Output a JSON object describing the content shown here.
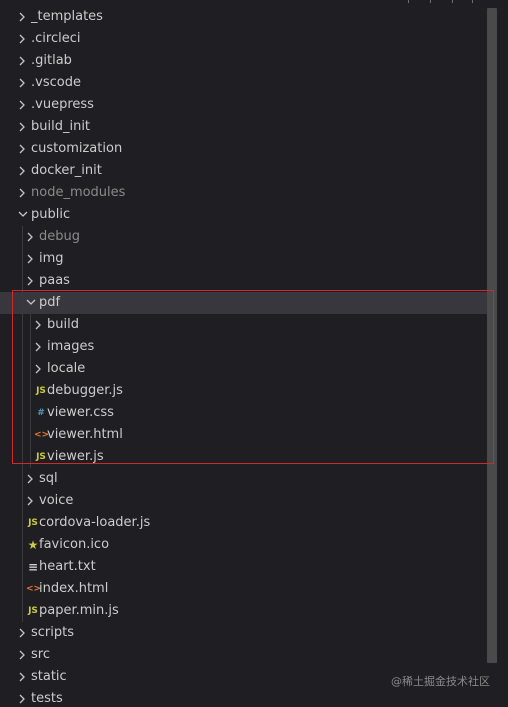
{
  "explorer": {
    "rows": [
      {
        "label": "_templates",
        "kind": "folder",
        "depth": 0,
        "open": false
      },
      {
        "label": ".circleci",
        "kind": "folder",
        "depth": 0,
        "open": false
      },
      {
        "label": ".gitlab",
        "kind": "folder",
        "depth": 0,
        "open": false
      },
      {
        "label": ".vscode",
        "kind": "folder",
        "depth": 0,
        "open": false
      },
      {
        "label": ".vuepress",
        "kind": "folder",
        "depth": 0,
        "open": false
      },
      {
        "label": "build_init",
        "kind": "folder",
        "depth": 0,
        "open": false
      },
      {
        "label": "customization",
        "kind": "folder",
        "depth": 0,
        "open": false
      },
      {
        "label": "docker_init",
        "kind": "folder",
        "depth": 0,
        "open": false
      },
      {
        "label": "node_modules",
        "kind": "folder",
        "depth": 0,
        "open": false,
        "muted": true
      },
      {
        "label": "public",
        "kind": "folder",
        "depth": 0,
        "open": true
      },
      {
        "label": "debug",
        "kind": "folder",
        "depth": 1,
        "open": false,
        "muted": true
      },
      {
        "label": "img",
        "kind": "folder",
        "depth": 1,
        "open": false
      },
      {
        "label": "paas",
        "kind": "folder",
        "depth": 1,
        "open": false
      },
      {
        "label": "pdf",
        "kind": "folder",
        "depth": 1,
        "open": true,
        "selected": true
      },
      {
        "label": "build",
        "kind": "folder",
        "depth": 2,
        "open": false
      },
      {
        "label": "images",
        "kind": "folder",
        "depth": 2,
        "open": false
      },
      {
        "label": "locale",
        "kind": "folder",
        "depth": 2,
        "open": false
      },
      {
        "label": "debugger.js",
        "kind": "js",
        "depth": 2
      },
      {
        "label": "viewer.css",
        "kind": "css",
        "depth": 2
      },
      {
        "label": "viewer.html",
        "kind": "html",
        "depth": 2
      },
      {
        "label": "viewer.js",
        "kind": "js",
        "depth": 2
      },
      {
        "label": "sql",
        "kind": "folder",
        "depth": 1,
        "open": false
      },
      {
        "label": "voice",
        "kind": "folder",
        "depth": 1,
        "open": false
      },
      {
        "label": "cordova-loader.js",
        "kind": "js",
        "depth": 1
      },
      {
        "label": "favicon.ico",
        "kind": "ico",
        "depth": 1
      },
      {
        "label": "heart.txt",
        "kind": "txt",
        "depth": 1
      },
      {
        "label": "index.html",
        "kind": "html",
        "depth": 1
      },
      {
        "label": "paper.min.js",
        "kind": "js",
        "depth": 1
      },
      {
        "label": "scripts",
        "kind": "folder",
        "depth": 0,
        "open": false
      },
      {
        "label": "src",
        "kind": "folder",
        "depth": 0,
        "open": false
      },
      {
        "label": "static",
        "kind": "folder",
        "depth": 0,
        "open": false
      },
      {
        "label": "tests",
        "kind": "folder",
        "depth": 0,
        "open": false
      }
    ]
  },
  "icons": {
    "js": {
      "glyph": "JS",
      "color": "#cbcb41"
    },
    "css": {
      "glyph": "#",
      "color": "#519aba"
    },
    "html": {
      "glyph": "<>",
      "color": "#e37933"
    },
    "ico": {
      "glyph": "★",
      "color": "#cbcb41"
    },
    "txt": {
      "glyph": "≡",
      "color": "#cccccc"
    }
  },
  "watermark": "@稀土掘金技术社区",
  "colors": {
    "highlight_border": "#d0282c",
    "selected_row": "#37373d"
  }
}
